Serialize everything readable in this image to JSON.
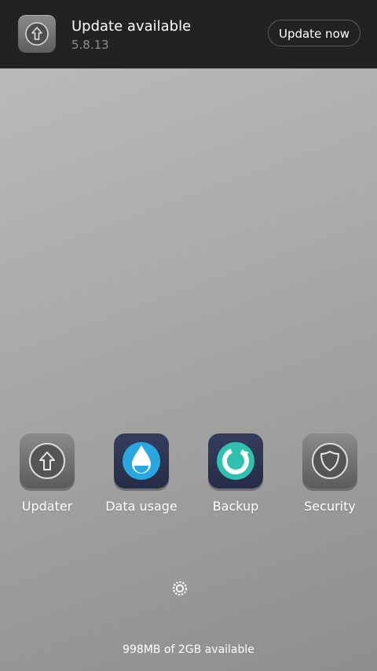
{
  "notification": {
    "title": "Update available",
    "version": "5.8.13",
    "button_label": "Update now",
    "icon": "update-arrow-icon"
  },
  "apps": [
    {
      "label": "Updater",
      "icon": "updater-icon"
    },
    {
      "label": "Data usage",
      "icon": "data-drop-icon"
    },
    {
      "label": "Backup",
      "icon": "backup-icon"
    },
    {
      "label": "Security",
      "icon": "shield-icon"
    }
  ],
  "settings_icon": "gear-icon",
  "storage_text": "998MB of 2GB available",
  "colors": {
    "notification_bg": "#222222",
    "accent_blue": "#2aa6e0",
    "accent_teal": "#2fc0b0",
    "icon_navy": "#2c3350",
    "icon_gray": "#6f6f6f"
  }
}
